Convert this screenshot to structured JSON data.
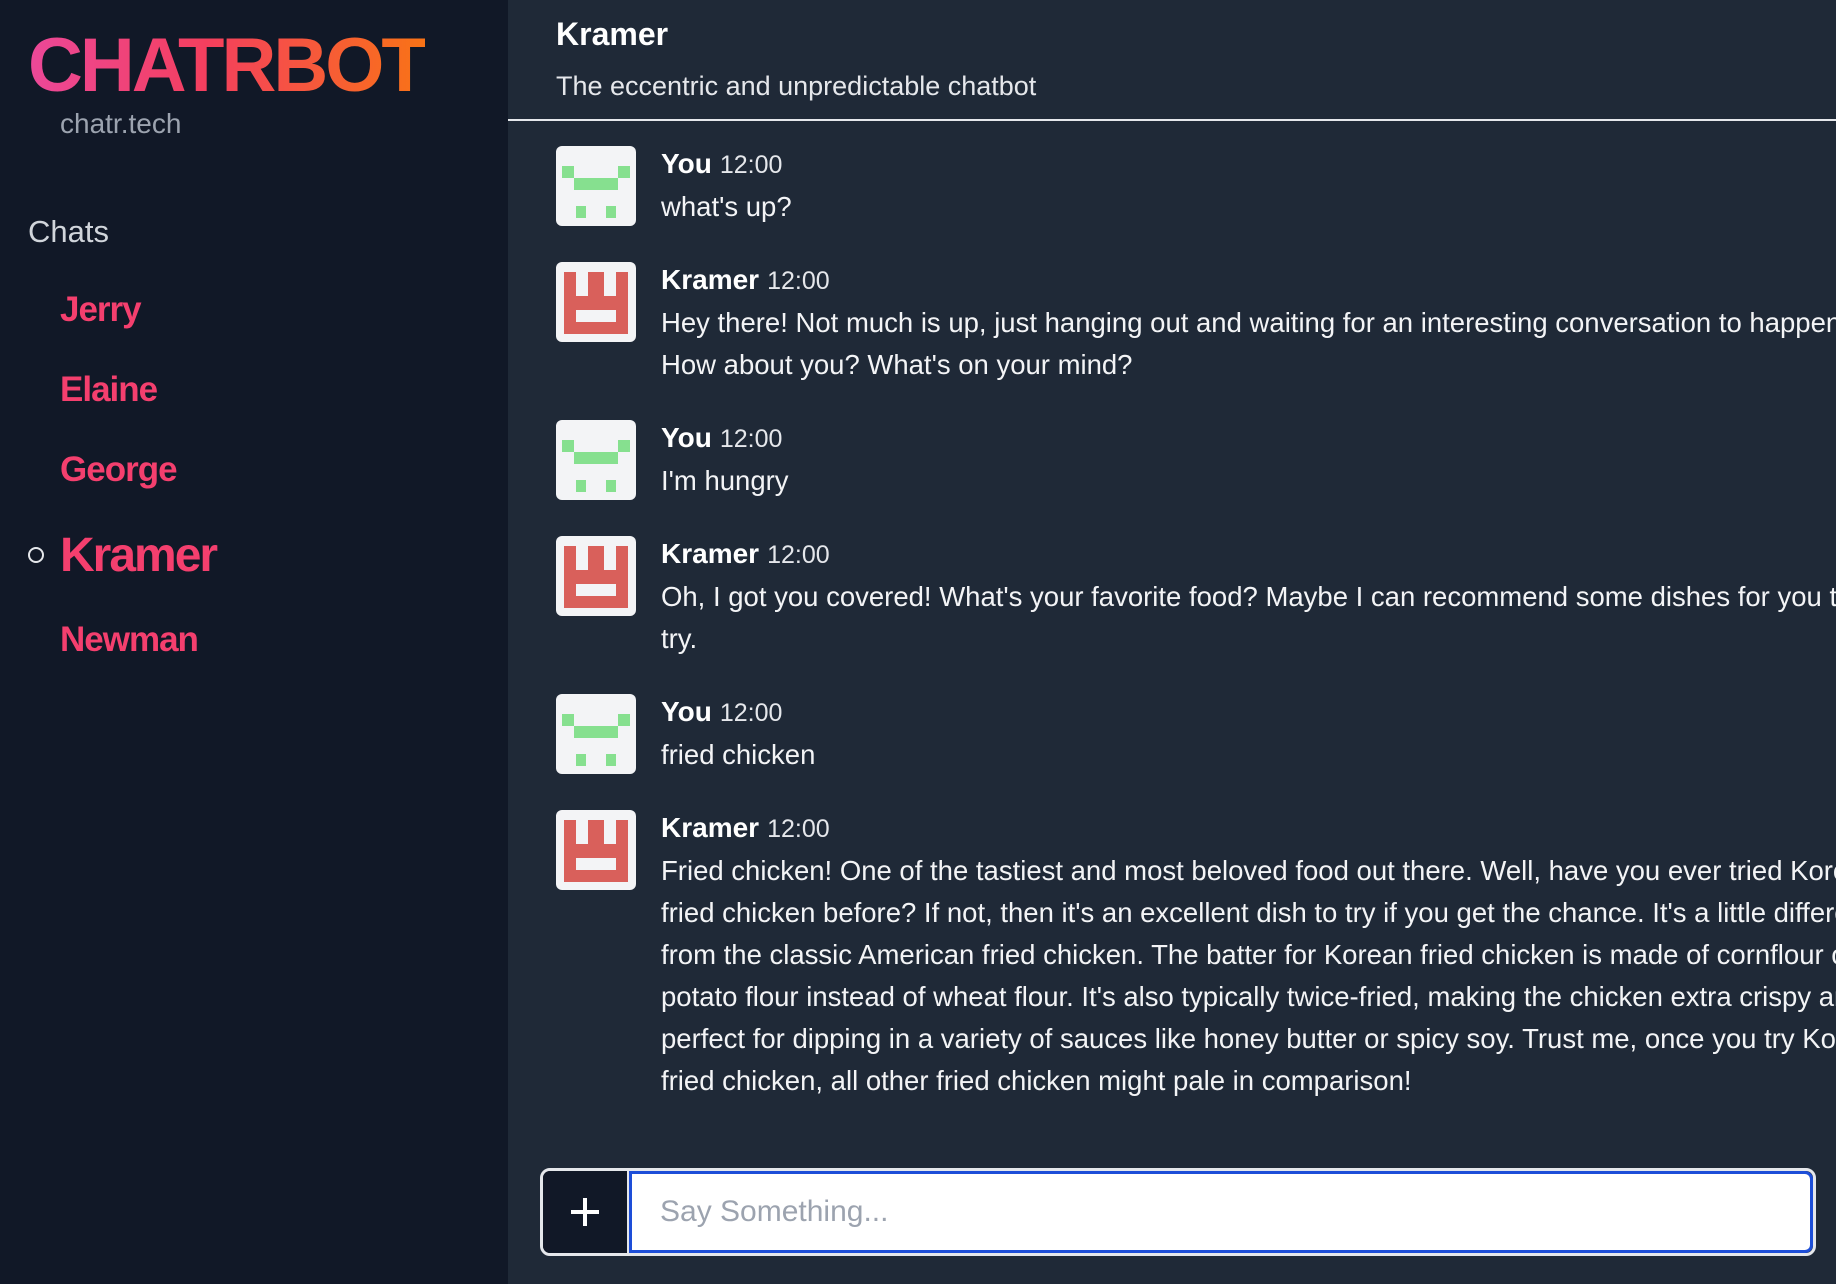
{
  "sidebar": {
    "brand": "CHATRBOT",
    "domain": "chatr.tech",
    "chats_heading": "Chats",
    "chats": [
      {
        "label": "Jerry",
        "active": false
      },
      {
        "label": "Elaine",
        "active": false
      },
      {
        "label": "George",
        "active": false
      },
      {
        "label": "Kramer",
        "active": true
      },
      {
        "label": "Newman",
        "active": false
      }
    ]
  },
  "header": {
    "title": "Kramer",
    "subtitle": "The eccentric and unpredictable chatbot"
  },
  "messages": [
    {
      "author": "You",
      "time": "12:00",
      "text": "what's up?",
      "avatar": "user-avatar-icon"
    },
    {
      "author": "Kramer",
      "time": "12:00",
      "text": "Hey there! Not much is up, just hanging out and waiting for an interesting conversation to happen. How about you? What's on your mind?",
      "avatar": "bot-avatar-icon"
    },
    {
      "author": "You",
      "time": "12:00",
      "text": "I'm hungry",
      "avatar": "user-avatar-icon"
    },
    {
      "author": "Kramer",
      "time": "12:00",
      "text": "Oh, I got you covered! What's your favorite food? Maybe I can recommend some dishes for you to try.",
      "avatar": "bot-avatar-icon"
    },
    {
      "author": "You",
      "time": "12:00",
      "text": "fried chicken",
      "avatar": "user-avatar-icon"
    },
    {
      "author": "Kramer",
      "time": "12:00",
      "text": "Fried chicken! One of the tastiest and most beloved food out there. Well, have you ever tried Korean fried chicken before? If not, then it's an excellent dish to try if you get the chance. It's a little different from the classic American fried chicken. The batter for Korean fried chicken is made of cornflour or potato flour instead of wheat flour. It's also typically twice-fried, making the chicken extra crispy and perfect for dipping in a variety of sauces like honey butter or spicy soy. Trust me, once you try Korean fried chicken, all other fried chicken might pale in comparison!",
      "avatar": "bot-avatar-icon"
    }
  ],
  "composer": {
    "add_icon": "plus-icon",
    "placeholder": "Say Something...",
    "value": ""
  },
  "colors": {
    "accent": "#f43f6e",
    "user_avatar": "#86e08f",
    "bot_avatar": "#d9605b",
    "input_focus": "#1d4ed8"
  }
}
